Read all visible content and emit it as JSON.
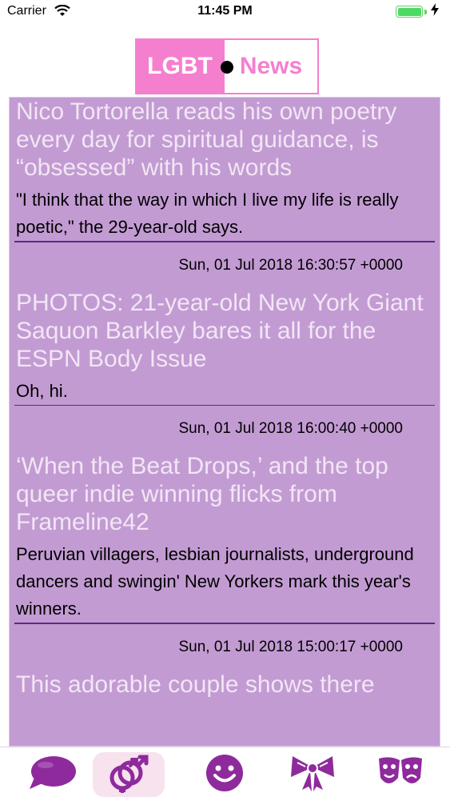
{
  "status_bar": {
    "carrier": "Carrier",
    "time": "11:45 PM",
    "battery_color": "#4cd964"
  },
  "logo": {
    "left_text": "LGBT",
    "right_text": "News",
    "accent_color": "#f57fcf"
  },
  "feed": {
    "background": "#c39bd3",
    "articles": [
      {
        "headline": "Nico Tortorella reads his own poetry every day for spiritual guidance, is “obsessed” with his words",
        "summary": "\"I think that the way in which I live my life is really poetic,\" the 29-year-old says.",
        "date": "Sun, 01 Jul 2018 16:30:57 +0000"
      },
      {
        "headline": "PHOTOS: 21-year-old New York Giant Saquon Barkley bares it all for the ESPN Body Issue",
        "summary": "Oh, hi.",
        "date": "Sun, 01 Jul 2018 16:00:40 +0000"
      },
      {
        "headline": "‘When the Beat Drops,’ and the top queer indie winning flicks from Frameline42",
        "summary": "Peruvian villagers, lesbian journalists, underground dancers and swingin' New Yorkers mark this year's winners.",
        "date": "Sun, 01 Jul 2018 15:00:17 +0000"
      },
      {
        "headline": "This adorable couple shows there",
        "summary": "",
        "date": ""
      }
    ]
  },
  "tab_bar": {
    "tabs": [
      {
        "icon": "speech-bubble-icon",
        "active": false
      },
      {
        "icon": "gender-symbols-icon",
        "active": true
      },
      {
        "icon": "smiley-icon",
        "active": false
      },
      {
        "icon": "bow-icon",
        "active": false
      },
      {
        "icon": "theater-masks-icon",
        "active": false
      }
    ],
    "icon_color": "#8e2a9c"
  }
}
